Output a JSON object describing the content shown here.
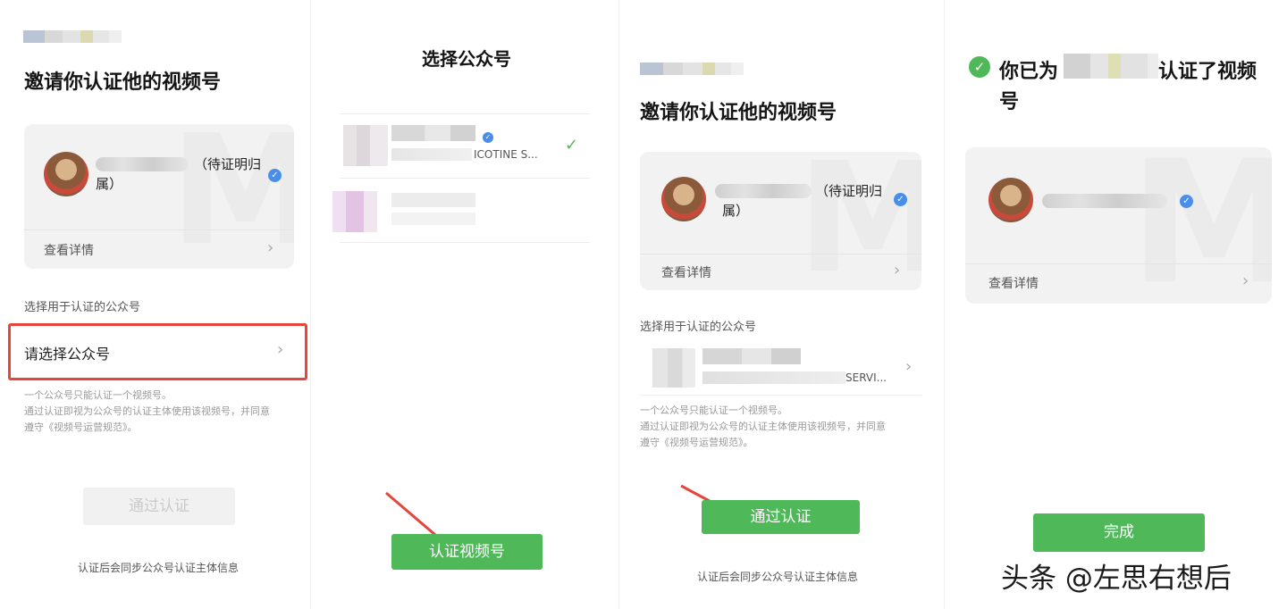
{
  "panel1": {
    "title": "邀请你认证他的视频号",
    "card_name_suffix": "（待证明归",
    "card_name_line2": "属）",
    "view_details": "查看详情",
    "select_label": "选择用于认证的公众号",
    "select_placeholder": "请选择公众号",
    "note_line1": "一个公众号只能认证一个视频号。",
    "note_line2": "通过认证即视为公众号的认证主体使用该视频号，并同意",
    "note_line3": "遵守《视频号运营规范》。",
    "button": "通过认证",
    "footer": "认证后会同步公众号认证主体信息"
  },
  "panel2": {
    "title": "选择公众号",
    "account1_sub": "ICOTINE S...",
    "button": "认证视频号"
  },
  "panel3": {
    "title": "邀请你认证他的视频号",
    "card_name_suffix": "（待证明归",
    "card_name_line2": "属）",
    "view_details": "查看详情",
    "select_label": "选择用于认证的公众号",
    "selected_account": "SERVI...",
    "note_line1": "一个公众号只能认证一个视频号。",
    "note_line2": "通过认证即视为公众号的认证主体使用该视频号，并同意",
    "note_line3": "遵守《视频号运营规范》。",
    "button": "通过认证",
    "footer": "认证后会同步公众号认证主体信息"
  },
  "panel4": {
    "title_prefix": "你已为",
    "title_suffix": "认证了视频",
    "title_line2": "号",
    "view_details": "查看详情",
    "button": "完成"
  },
  "watermark": "头条 @左思右想后",
  "colors": {
    "accent_green": "#4fb95a",
    "highlight_red": "#e5453a",
    "verify_blue": "#4a8eea"
  }
}
